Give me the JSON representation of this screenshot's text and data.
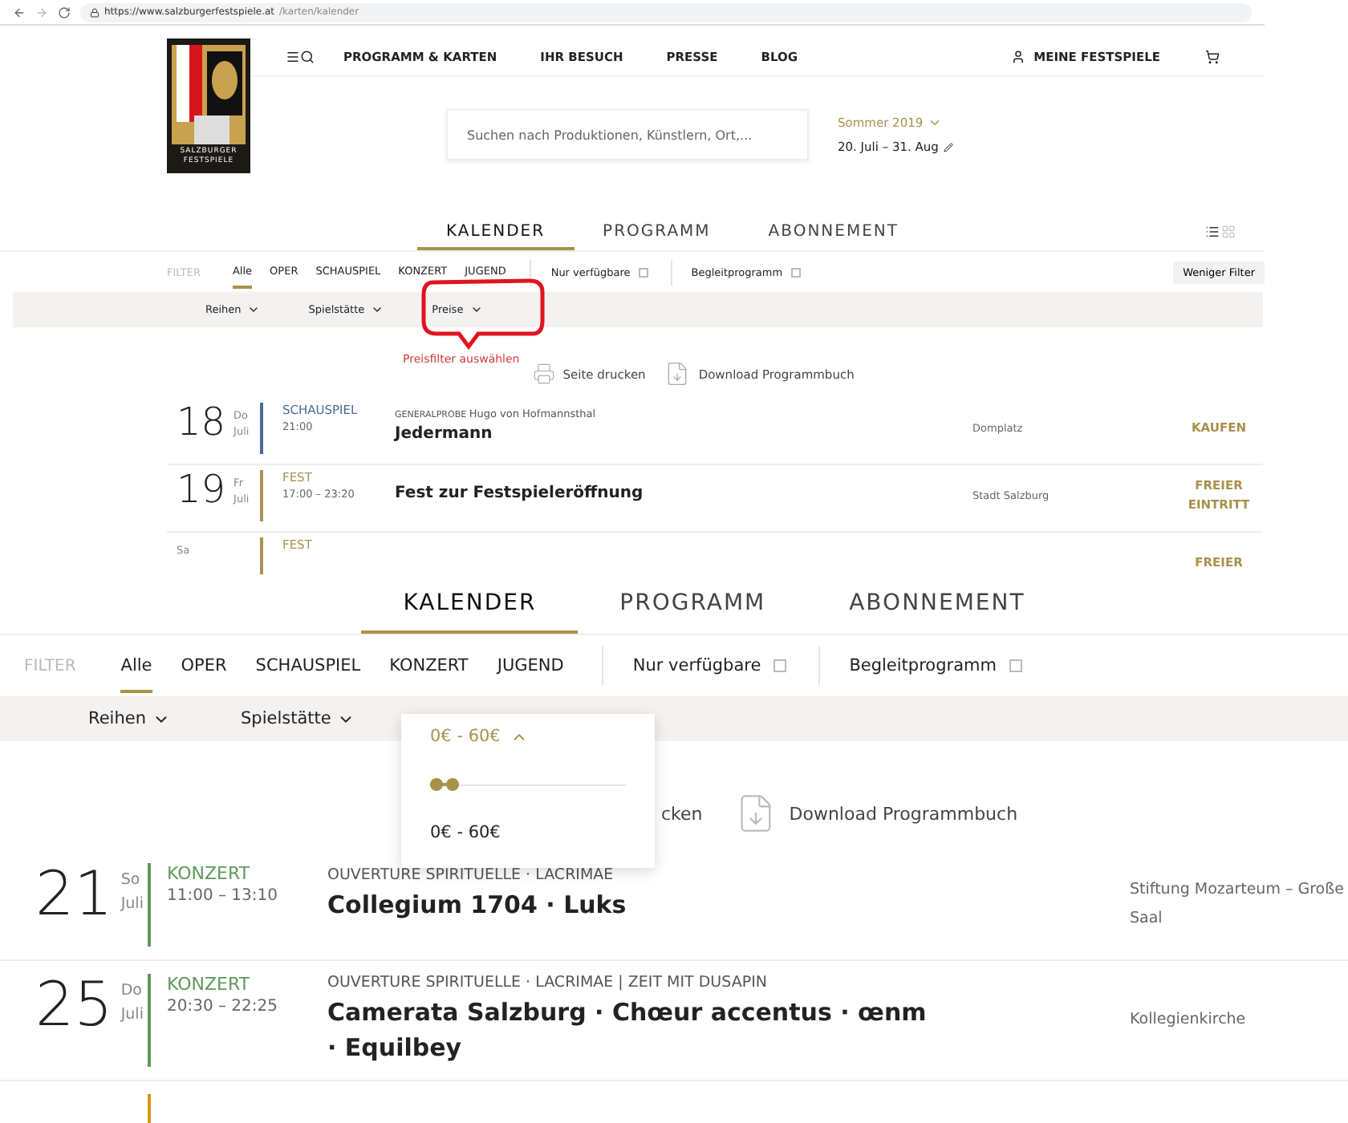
{
  "browser": {
    "url_host": "https://www.salzburgerfestspiele.at",
    "url_path": "/karten/kalender"
  },
  "header": {
    "logo_lines": [
      "SALZBURGER",
      "FESTSPIELE"
    ],
    "nav": [
      "PROGRAMM & KARTEN",
      "IHR BESUCH",
      "PRESSE",
      "BLOG"
    ],
    "account": "MEINE FESTSPIELE",
    "search": {
      "placeholder": "Suchen nach Produktionen, Künstlern, Ort,..."
    },
    "season": {
      "label": "Sommer 2019",
      "dates": "20. Juli – 31. Aug"
    }
  },
  "overview": {
    "tabs": [
      {
        "label": "KALENDER",
        "selected": true
      },
      {
        "label": "PROGRAMM",
        "selected": false
      },
      {
        "label": "ABONNEMENT",
        "selected": false
      }
    ],
    "filter_label": "FILTER",
    "categories": [
      {
        "label": "Alle",
        "selected": true
      },
      {
        "label": "OPER",
        "selected": false
      },
      {
        "label": "SCHAUSPIEL",
        "selected": false
      },
      {
        "label": "KONZERT",
        "selected": false
      },
      {
        "label": "JUGEND",
        "selected": false
      }
    ],
    "checkboxes": [
      {
        "label": "Nur verfügbare",
        "checked": false
      },
      {
        "label": "Begleitprogramm",
        "checked": false
      }
    ],
    "less_filters": "Weniger Filter",
    "dropdowns": [
      "Reihen",
      "Spielstätte",
      "Preise"
    ],
    "annotation": "Preisfilter auswählen",
    "actions": [
      "Seite drucken",
      "Download Programmbuch"
    ],
    "events": [
      {
        "day": "18",
        "weekday": "Do",
        "month": "Juli",
        "category": "SCHAUSPIEL",
        "color": "#4d6a96",
        "time": "21:00",
        "pre": "GENERALPROBE",
        "subtitle": "Hugo von Hofmannsthal",
        "title": "Jedermann",
        "venue": "Domplatz",
        "action": "KAUFEN"
      },
      {
        "day": "19",
        "weekday": "Fr",
        "month": "Juli",
        "category": "FEST",
        "color": "#a89254",
        "time": "17:00 – 23:20",
        "title": "Fest zur Festspieleröffnung",
        "venue": "Stadt Salzburg",
        "action": "FREIER EINTRITT"
      },
      {
        "weekday": "Sa",
        "category": "FEST",
        "color": "#a89254",
        "action": "FREIER"
      }
    ]
  },
  "detail": {
    "tabs": [
      {
        "label": "KALENDER",
        "selected": true
      },
      {
        "label": "PROGRAMM",
        "selected": false
      },
      {
        "label": "ABONNEMENT",
        "selected": false
      }
    ],
    "filter_label": "FILTER",
    "categories": [
      {
        "label": "Alle",
        "selected": true
      },
      {
        "label": "OPER",
        "selected": false
      },
      {
        "label": "SCHAUSPIEL",
        "selected": false
      },
      {
        "label": "KONZERT",
        "selected": false
      },
      {
        "label": "JUGEND",
        "selected": false
      }
    ],
    "checkboxes": [
      {
        "label": "Nur verfügbare",
        "checked": false
      },
      {
        "label": "Begleitprogramm",
        "checked": false
      }
    ],
    "dropdowns": [
      "Reihen",
      "Spielstätte"
    ],
    "price": {
      "value": "0€ - 60€",
      "level": 0.08,
      "reading": "0€ - 60€"
    },
    "actions": [
      "cken",
      "Download Programmbuch"
    ],
    "events": [
      {
        "day": "21",
        "weekday": "So",
        "month": "Juli",
        "category": "KONZERT",
        "color": "#5f9a5a",
        "time": "11:00 – 13:10",
        "subtitle": "OUVERTURE SPIRITUELLE · LACRIMAE",
        "title": "Collegium 1704 · Luks",
        "venue": "Stiftung Mozarteum – Große Saal"
      },
      {
        "day": "25",
        "weekday": "Do",
        "month": "Juli",
        "category": "KONZERT",
        "color": "#5f9a5a",
        "time": "20:30 – 22:25",
        "subtitle": "OUVERTURE SPIRITUELLE · LACRIMAE | ZEIT MIT DUSAPIN",
        "title": "Camerata Salzburg · Chœur accentus · œnm · Equilbey",
        "venue": "Kollegienkirche"
      },
      {
        "color": "#d9931c"
      }
    ]
  }
}
